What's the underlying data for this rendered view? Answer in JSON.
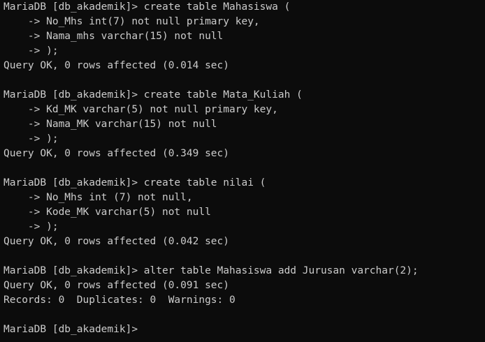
{
  "terminal": {
    "lines": [
      "MariaDB [db_akademik]> create table Mahasiswa (",
      "    -> No_Mhs int(7) not null primary key,",
      "    -> Nama_mhs varchar(15) not null",
      "    -> );",
      "Query OK, 0 rows affected (0.014 sec)",
      "",
      "MariaDB [db_akademik]> create table Mata_Kuliah (",
      "    -> Kd_MK varchar(5) not null primary key,",
      "    -> Nama_MK varchar(15) not null",
      "    -> );",
      "Query OK, 0 rows affected (0.349 sec)",
      "",
      "MariaDB [db_akademik]> create table nilai (",
      "    -> No_Mhs int (7) not null,",
      "    -> Kode_MK varchar(5) not null",
      "    -> );",
      "Query OK, 0 rows affected (0.042 sec)",
      "",
      "MariaDB [db_akademik]> alter table Mahasiswa add Jurusan varchar(2);",
      "Query OK, 0 rows affected (0.091 sec)",
      "Records: 0  Duplicates: 0  Warnings: 0",
      "",
      "MariaDB [db_akademik]>"
    ]
  },
  "colors": {
    "background": "#0c0c0c",
    "text": "#cccccc"
  }
}
